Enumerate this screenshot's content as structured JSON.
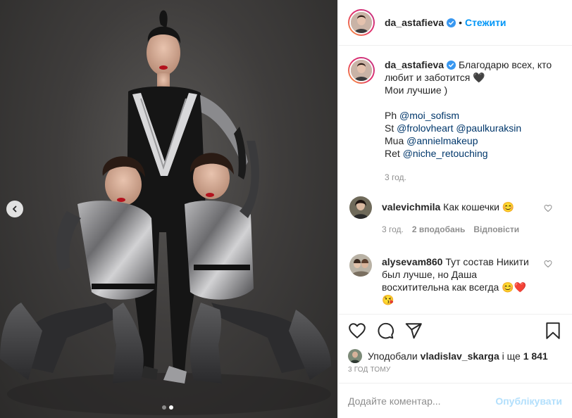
{
  "post": {
    "author": {
      "username": "da_astafieva",
      "verified": true,
      "follow_label": "Стежити",
      "separator": "•"
    },
    "media": {
      "image_description": "three women in metallic bodysuits posing",
      "carousel": {
        "total": 2,
        "active_index": 2
      }
    },
    "caption": {
      "username": "da_astafieva",
      "text_line1": "Благодарю всех, кто любит и заботится 🖤",
      "text_line2": "Мои лучшие )",
      "credits": [
        {
          "prefix": "Ph",
          "mentions": [
            "@moi_sofism"
          ]
        },
        {
          "prefix": "St",
          "mentions": [
            "@frolovheart",
            "@paulkuraksin"
          ]
        },
        {
          "prefix": "Mua",
          "mentions": [
            "@annielmakeup"
          ]
        },
        {
          "prefix": "Ret",
          "mentions": [
            "@niche_retouching"
          ]
        }
      ],
      "age": "3 год."
    },
    "comments": [
      {
        "username": "valevichmila",
        "text": "Как кошечки 😊",
        "age": "3 год.",
        "likes": "2 вподобань",
        "reply": "Відповісти"
      },
      {
        "username": "alysevam860",
        "text": "Тут состав Никити был лучше, но Даша восхитительна как всегда 😊❤️ 😘"
      }
    ],
    "likes": {
      "prefix": "Уподобали",
      "user": "vladislav_skarga",
      "suffix": "і ще",
      "count": "1 841"
    },
    "timestamp": "3 ГОД ТОМУ",
    "add_comment": {
      "placeholder": "Додайте коментар...",
      "publish_label": "Опублікувати"
    }
  },
  "colors": {
    "accent": "#0095f6",
    "mention": "#00376b",
    "muted": "#8e8e8e",
    "publish_disabled": "#b2dffc",
    "heart_red": "#ed4956"
  },
  "icons": [
    "chevron-left-icon",
    "verified-badge-icon",
    "heart-icon",
    "comment-icon",
    "share-icon",
    "bookmark-icon"
  ]
}
